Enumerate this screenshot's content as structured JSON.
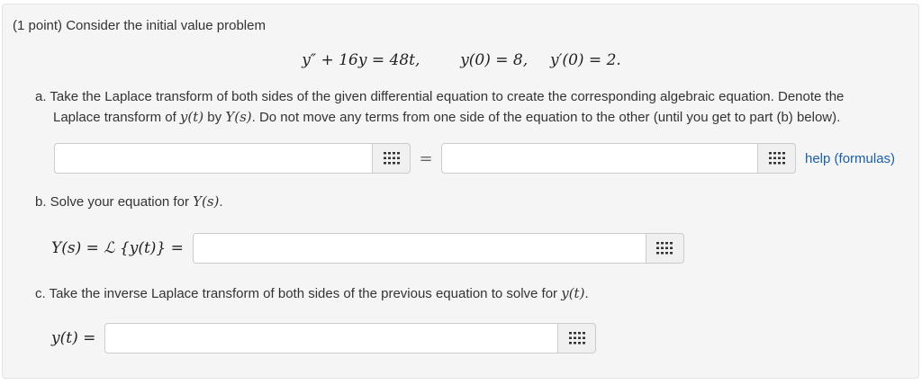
{
  "problem": {
    "intro": "(1 point) Consider the initial value problem",
    "equation": "y″ + 16y = 48t,",
    "initial_condition_1": "y(0) = 8,",
    "initial_condition_2": "y′(0) = 2."
  },
  "part_a": {
    "line1": "a. Take the Laplace transform of both sides of the given differential equation to create the corresponding algebraic equation. Denote the",
    "line2_prefix": "Laplace transform of ",
    "line2_yt": "y(t)",
    "line2_by": " by ",
    "line2_Ys": "Y(s)",
    "line2_suffix": ". Do not move any terms from one side of the equation to the other (until you get to part (b) below).",
    "left_value": "",
    "equals": "=",
    "right_value": "",
    "help_link": "help (formulas)"
  },
  "part_b": {
    "prefix": "b. Solve your equation for ",
    "var": "Y(s)",
    "suffix": ".",
    "lhs": "Y(s) = ℒ {y(t)} =",
    "value": ""
  },
  "part_c": {
    "prefix": "c. Take the inverse Laplace transform of both sides of the previous equation to solve for ",
    "var": "y(t)",
    "suffix": ".",
    "lhs": "y(t) =",
    "value": ""
  },
  "icons": {
    "equation_editor": "grid-icon"
  }
}
